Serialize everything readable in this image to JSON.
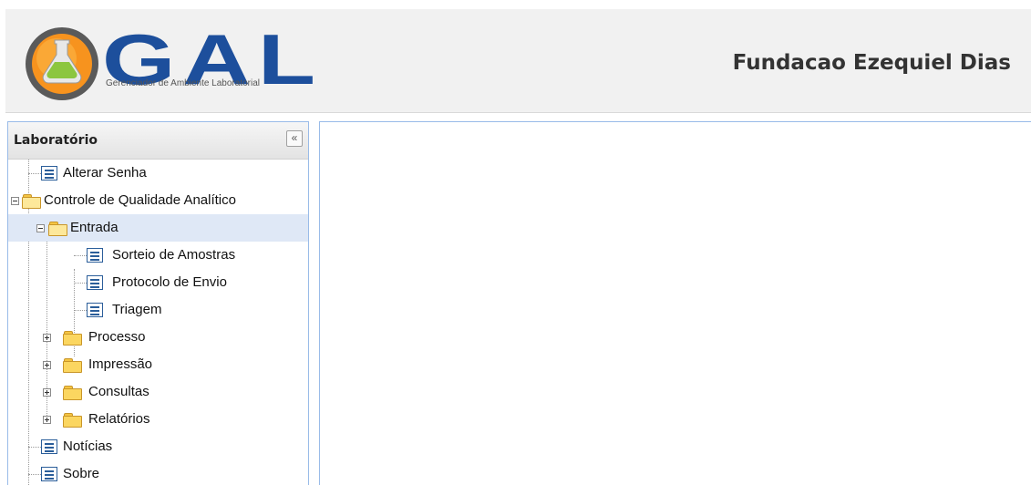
{
  "header": {
    "logo_text": "GAL",
    "logo_subtitle": "Gerenciador de Ambiente Laboratorial",
    "organization": "Fundacao Ezequiel Dias"
  },
  "panel": {
    "title": "Laboratório",
    "collapse_glyph": "«"
  },
  "tree": {
    "alterar_senha": "Alterar Senha",
    "controle": "Controle de Qualidade Analítico",
    "entrada": "Entrada",
    "sorteio": "Sorteio de Amostras",
    "protocolo": "Protocolo de Envio",
    "triagem": "Triagem",
    "processo": "Processo",
    "impressao": "Impressão",
    "consultas": "Consultas",
    "relatorios": "Relatórios",
    "noticias": "Notícias",
    "sobre": "Sobre"
  },
  "colors": {
    "logo_blue": "#1d4f9c",
    "logo_orange": "#f7931e",
    "selected_row": "#dfe8f6",
    "panel_border": "#99bbe8"
  }
}
